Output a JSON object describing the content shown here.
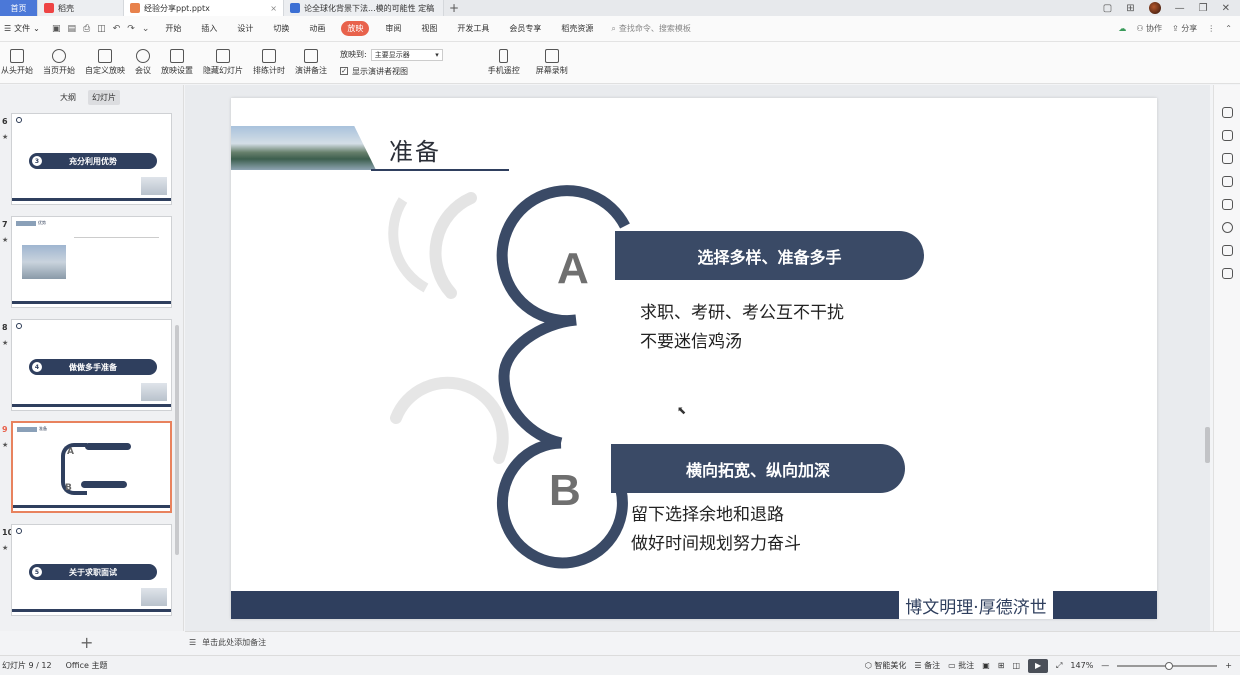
{
  "titlebar": {
    "tabs": [
      {
        "label": "首页"
      },
      {
        "label": "稻壳"
      },
      {
        "label": "经验分享ppt.pptx"
      },
      {
        "label": "论全球化背景下法...模的可能性 定稿"
      }
    ],
    "new_tab": "+"
  },
  "menubar": {
    "file": "文件",
    "items": [
      "开始",
      "插入",
      "设计",
      "切换",
      "动画",
      "放映",
      "审阅",
      "视图",
      "开发工具",
      "会员专享",
      "稻壳资源"
    ],
    "search_placeholder": "查找命令、搜索模板",
    "collab": "协作",
    "share": "分享"
  },
  "toolbar": {
    "tools": [
      "从头开始",
      "当页开始",
      "自定义放映",
      "会议",
      "放映设置",
      "隐藏幻灯片",
      "排练计时",
      "演讲备注"
    ],
    "play_to_label": "放映到:",
    "play_to_value": "主要显示器",
    "presenter_view": "显示演讲者视图",
    "phone_remote": "手机遥控",
    "screen_record": "屏幕录制"
  },
  "leftpanel": {
    "tab_outline": "大纲",
    "tab_slides": "幻灯片",
    "thumbs": [
      {
        "num": "6",
        "title": "充分利用优势",
        "badge": "3"
      },
      {
        "num": "7",
        "title": "优势"
      },
      {
        "num": "8",
        "title": "做做多手准备",
        "badge": "4"
      },
      {
        "num": "9",
        "title": "准备"
      },
      {
        "num": "10",
        "title": "关于求职面试",
        "badge": "5"
      }
    ],
    "add": "+"
  },
  "slide": {
    "title": "准备",
    "item_a": {
      "letter": "A",
      "heading": "选择多样、准备多手",
      "line1": "求职、考研、考公互不干扰",
      "line2": "不要迷信鸡汤"
    },
    "item_b": {
      "letter": "B",
      "heading": "横向拓宽、纵向加深",
      "line1": "留下选择余地和退路",
      "line2": "做好时间规划努力奋斗"
    },
    "footer": "博文明理·厚德济世"
  },
  "notes": {
    "placeholder": "单击此处添加备注"
  },
  "status": {
    "slide_count": "幻灯片 9 / 12",
    "theme": "Office 主题",
    "beautify": "智能美化",
    "notes": "备注",
    "comments": "批注",
    "zoom": "147%"
  },
  "colors": {
    "accent": "#e8624c",
    "navy": "#3a4a66",
    "home_tab": "#4b78d8"
  }
}
